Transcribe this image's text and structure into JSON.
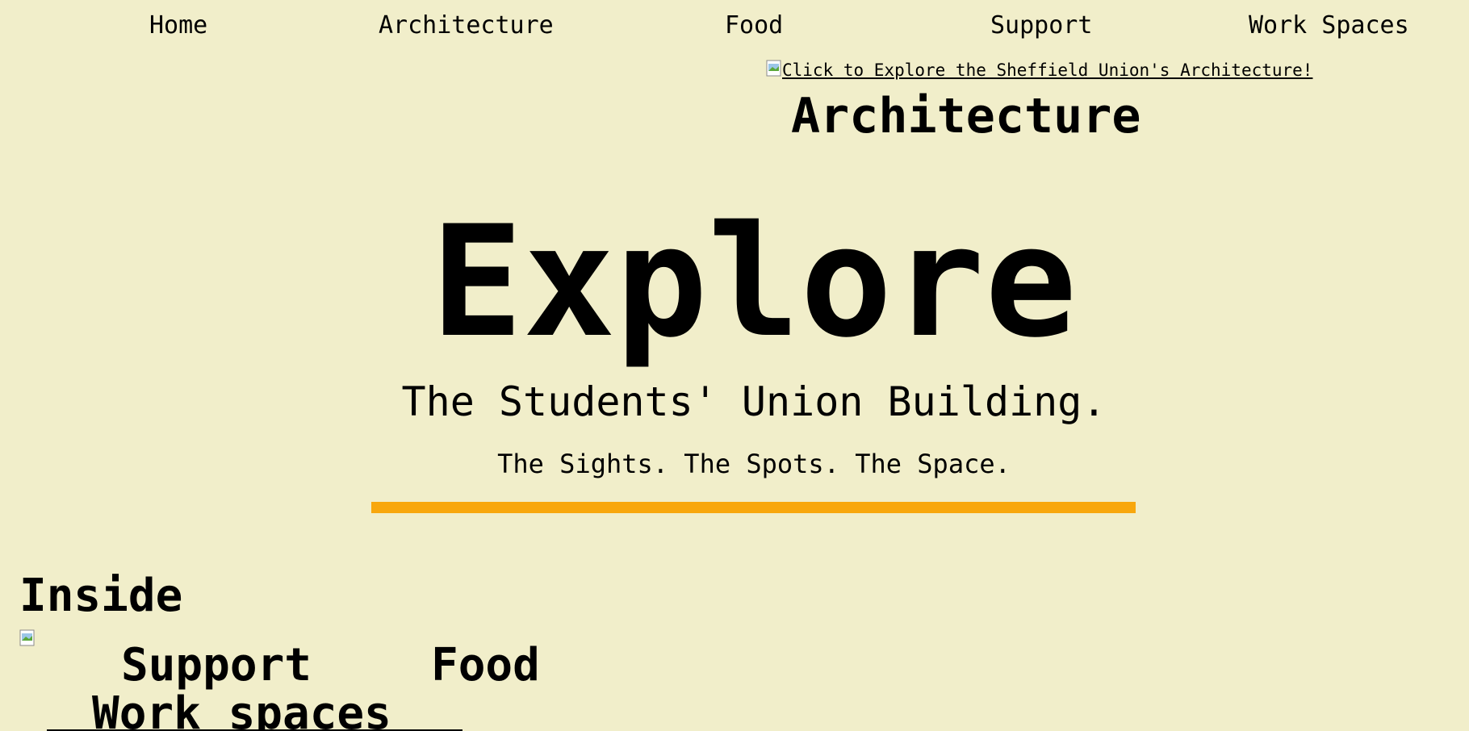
{
  "nav": {
    "items": [
      {
        "label": "Home"
      },
      {
        "label": "Architecture"
      },
      {
        "label": "Food"
      },
      {
        "label": "Support"
      },
      {
        "label": "Work Spaces"
      }
    ]
  },
  "architecture_section": {
    "image_alt": "Click to Explore the Sheffield Union's Architecture!",
    "title": "Architecture"
  },
  "hero": {
    "title": "Explore",
    "subtitle": "The Students' Union Building.",
    "tagline": "The Sights. The Spots. The Space.",
    "divider_color": "#f8a70d"
  },
  "inside_section": {
    "title": "Inside",
    "tiles": {
      "support": "Support",
      "food": "Food",
      "work_spaces": "Work spaces"
    }
  },
  "colors": {
    "background": "#f1eeca",
    "text": "#000000",
    "accent": "#f8a70d"
  },
  "icons": {
    "broken_image": "broken-image-icon"
  }
}
